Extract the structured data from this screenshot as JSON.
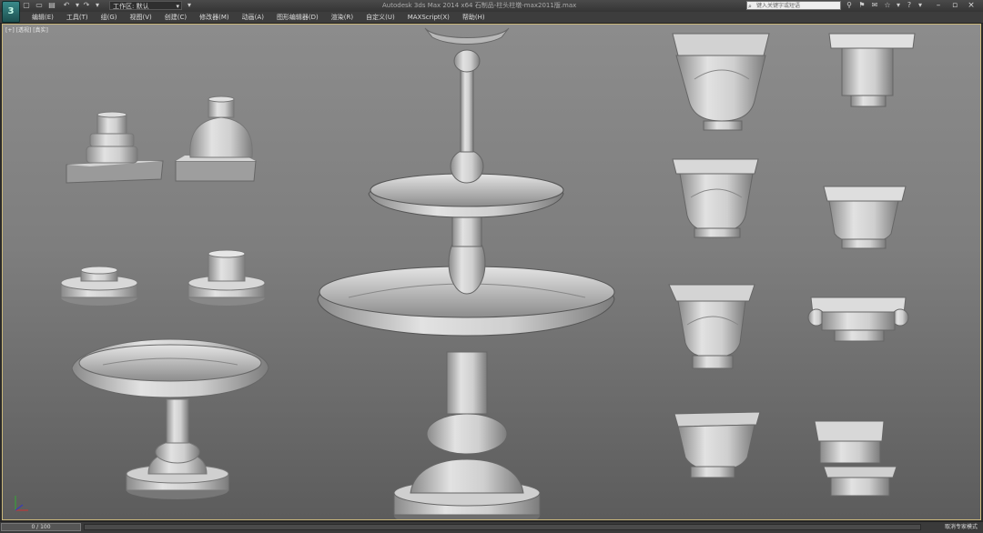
{
  "titlebar": {
    "title": "Autodesk 3ds Max 2014 x64   石制品-柱头柱墩-max2011版.max",
    "workspace_label": "工作区: 默认",
    "search_placeholder": "键入关键字或短语"
  },
  "menu": [
    "编辑(E)",
    "工具(T)",
    "组(G)",
    "视图(V)",
    "创建(C)",
    "修改器(M)",
    "动画(A)",
    "图形编辑器(D)",
    "渲染(R)",
    "自定义(U)",
    "MAXScript(X)",
    "帮助(H)"
  ],
  "viewport": {
    "label": "[+] [透视] [真实]"
  },
  "statusbar": {
    "frame": "0 / 100",
    "status": "取消专家模式"
  },
  "colors": {
    "accent": "#c9b77a",
    "viewport_top": "#8c8c8c",
    "viewport_bottom": "#5c5c5c",
    "model": "#c8c8c8"
  }
}
